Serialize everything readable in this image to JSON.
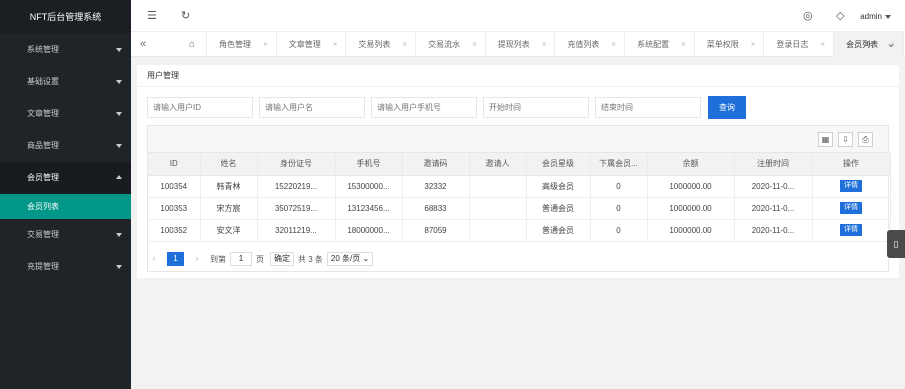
{
  "app": {
    "title": "NFT后台管理系统"
  },
  "sidebar": {
    "items": [
      {
        "label": "系统管理",
        "open": false
      },
      {
        "label": "基础设置",
        "open": false
      },
      {
        "label": "文章管理",
        "open": false
      },
      {
        "label": "商品管理",
        "open": false
      },
      {
        "label": "会员管理",
        "open": true,
        "children": [
          {
            "label": "会员列表",
            "active": true
          }
        ]
      },
      {
        "label": "交易管理",
        "open": false
      },
      {
        "label": "充提管理",
        "open": false
      }
    ]
  },
  "header": {
    "icons": [
      "menu-fold-icon",
      "refresh-icon",
      "theme-icon",
      "tag-icon"
    ],
    "user": "admin"
  },
  "tabs": {
    "items": [
      "角色管理",
      "文章管理",
      "交易列表",
      "交易流水",
      "提现列表",
      "充值列表",
      "系统配置",
      "菜单权限",
      "登录日志",
      "会员列表"
    ],
    "active": "会员列表"
  },
  "main": {
    "card_title": "用户管理",
    "search": {
      "placeholders": [
        "请输入用户ID",
        "请输入用户名",
        "请输入用户手机号",
        "开始时间",
        "结束时间"
      ],
      "button": "查询"
    },
    "table": {
      "columns": [
        "ID",
        "姓名",
        "身份证号",
        "手机号",
        "邀请码",
        "邀请人",
        "会员星级",
        "下属会员...",
        "余额",
        "注册时间",
        "操作"
      ],
      "rows": [
        [
          "100354",
          "韩青林",
          "15220219...",
          "15300000...",
          "32332",
          "",
          "高级会员",
          "0",
          "1000000.00",
          "2020-11-0...",
          "详情"
        ],
        [
          "100353",
          "宋方宸",
          "35072519...",
          "13123456...",
          "68833",
          "",
          "普通会员",
          "0",
          "1000000.00",
          "2020-11-0...",
          "详情"
        ],
        [
          "100352",
          "安文洋",
          "32011219...",
          "18000000...",
          "87059",
          "",
          "普通会员",
          "0",
          "1000000.00",
          "2020-11-0...",
          "详情"
        ]
      ]
    },
    "pager": {
      "current": "1",
      "goto_label": "到第",
      "page_value": "1",
      "page_unit": "页",
      "confirm": "确定",
      "total": "共 3 条",
      "page_size": "20 条/页"
    }
  },
  "colors": {
    "sidebar_bg": "#1f2429",
    "active_menu": "#009688",
    "primary": "#1e6fd9"
  }
}
